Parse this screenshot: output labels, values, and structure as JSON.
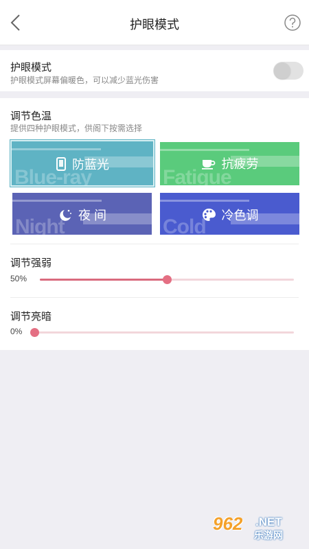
{
  "header": {
    "title": "护眼模式"
  },
  "eye_mode": {
    "title": "护眼模式",
    "subtitle": "护眼模式屏幕偏暖色，可以减少蓝光伤害",
    "enabled": false
  },
  "color_temp": {
    "title": "调节色温",
    "subtitle": "提供四种护眼模式，供阁下按需选择",
    "cards": [
      {
        "label": "防蓝光",
        "bg_text": "Blue-ray",
        "icon": "phone-icon",
        "color": "#5fb3c4",
        "selected": true
      },
      {
        "label": "抗疲劳",
        "bg_text": "Fatigue",
        "icon": "coffee-cup-icon",
        "color": "#5acb7c",
        "selected": false
      },
      {
        "label": "夜 间",
        "bg_text": "Night",
        "icon": "moon-stars-icon",
        "color": "#5b63b5",
        "selected": false
      },
      {
        "label": "冷色调",
        "bg_text": "Cold",
        "icon": "palette-icon",
        "color": "#4a5bcf",
        "selected": false
      }
    ]
  },
  "intensity": {
    "title": "调节强弱",
    "value_label": "50%",
    "value": 0.5
  },
  "brightness": {
    "title": "调节亮暗",
    "value_label": "0%",
    "value": 0.0
  },
  "colors": {
    "slider": "#e46f83",
    "slider_track": "#f2d6db"
  },
  "watermark": {
    "number": "962",
    "suffix": ".NET",
    "text": "乐游网"
  }
}
